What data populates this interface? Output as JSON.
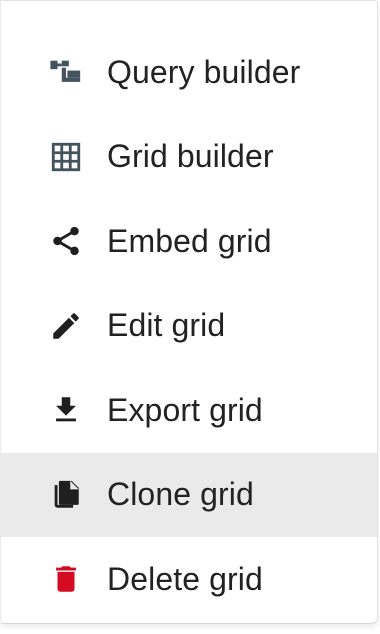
{
  "menu": {
    "items": [
      {
        "label": "Query builder",
        "icon": "query-builder-icon"
      },
      {
        "label": "Grid builder",
        "icon": "grid-icon"
      },
      {
        "label": "Embed grid",
        "icon": "share-icon"
      },
      {
        "label": "Edit grid",
        "icon": "pencil-icon"
      },
      {
        "label": "Export grid",
        "icon": "download-icon"
      },
      {
        "label": "Clone grid",
        "icon": "copy-icon",
        "hovered": true
      },
      {
        "label": "Delete grid",
        "icon": "trash-icon"
      }
    ]
  },
  "colors": {
    "icon": "#44545e",
    "icon_dark": "#1f1f1f",
    "danger": "#d50b22",
    "hover_bg": "#eaeaea",
    "text": "#222222"
  }
}
